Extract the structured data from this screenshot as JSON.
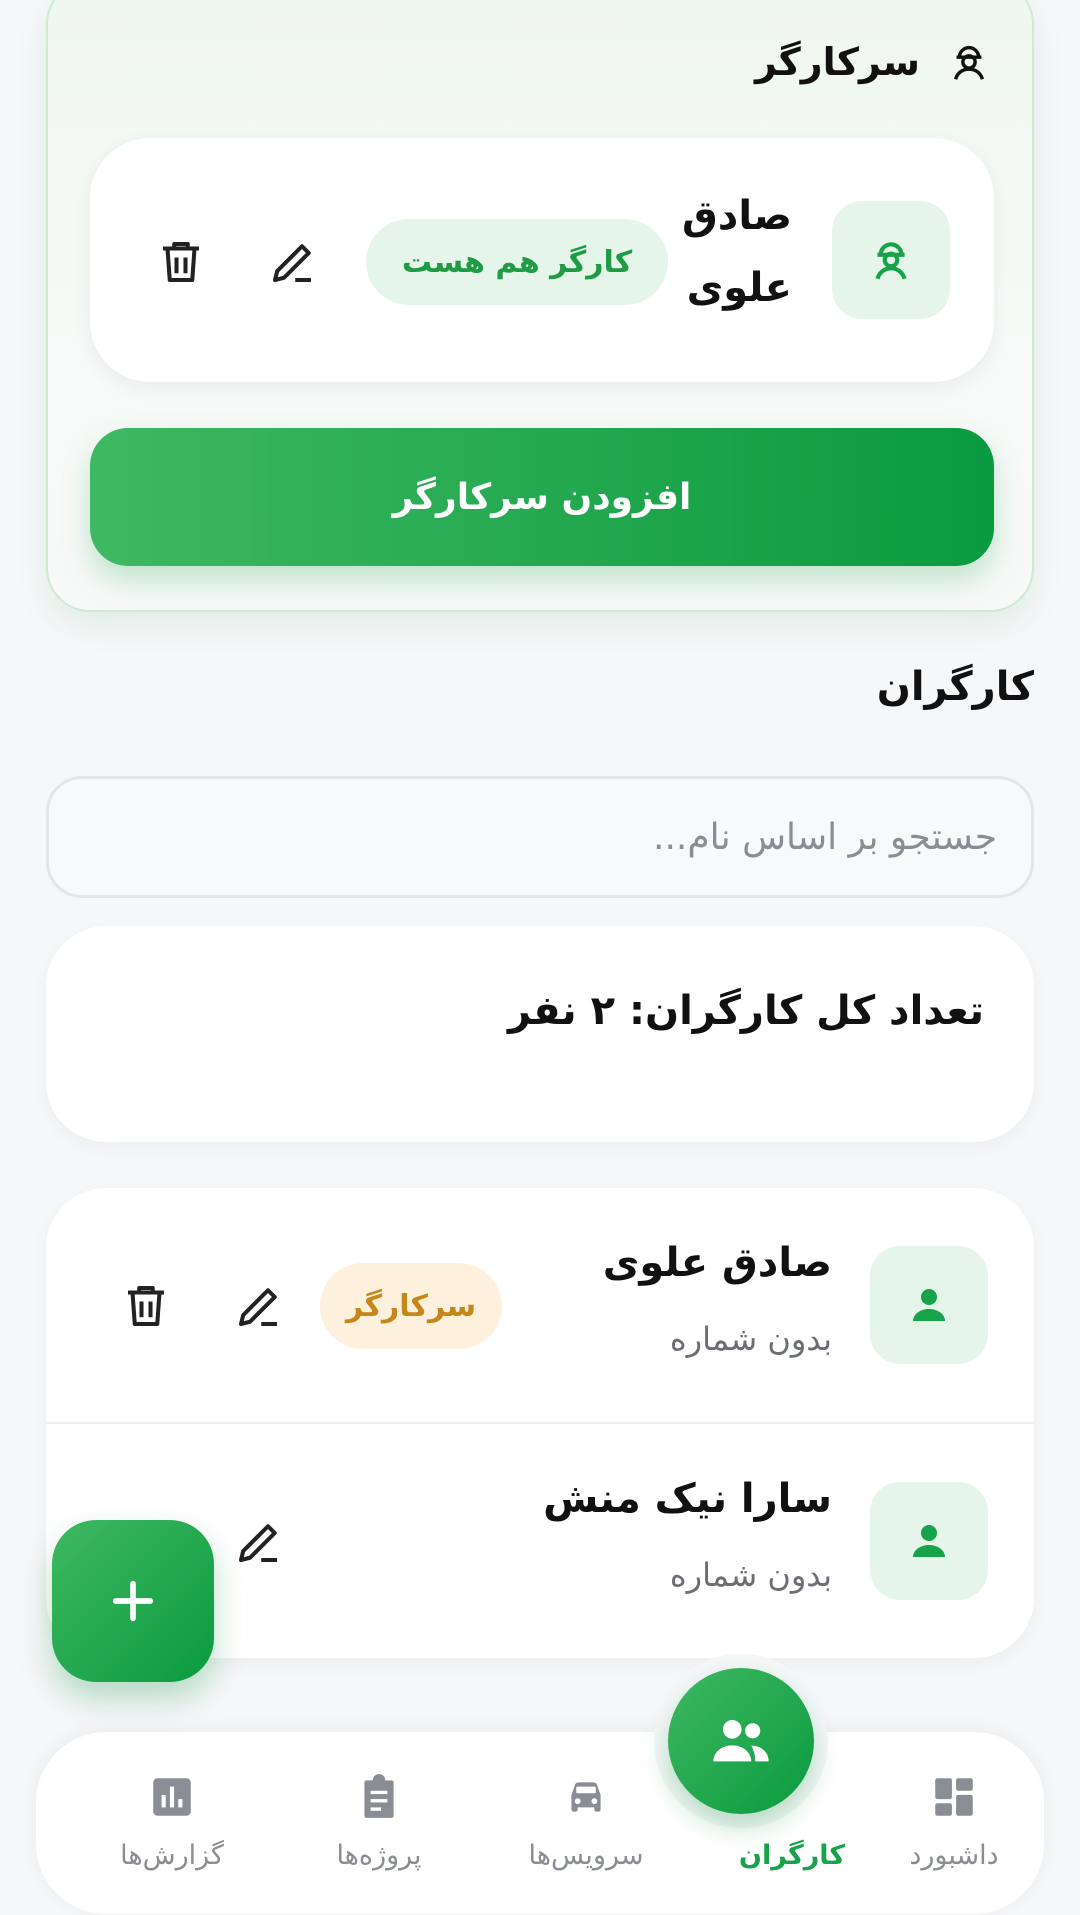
{
  "supervisor_section": {
    "title": "سرکارگر",
    "item": {
      "name_line1": "صادق",
      "name_line2": "علوی",
      "badge": "کارگر هم هست"
    },
    "add_button_label": "افزودن سرکارگر"
  },
  "workers_section": {
    "title": "کارگران",
    "search_placeholder": "جستجو بر اساس نام...",
    "count_text": "تعداد کل کارگران: ۲ نفر",
    "workers": [
      {
        "name": "صادق علوی",
        "phone": "بدون شماره",
        "badge": "سرکارگر"
      },
      {
        "name": "سارا نیک منش",
        "phone": "بدون شماره"
      }
    ]
  },
  "fab": {
    "icon": "plus-icon"
  },
  "bottom_nav": {
    "items": [
      {
        "label": "داشبورد",
        "icon": "dashboard-icon"
      },
      {
        "label": "کارگران",
        "icon": "group-icon",
        "active": true
      },
      {
        "label": "سرویس‌ها",
        "icon": "car-icon"
      },
      {
        "label": "پروژه‌ها",
        "icon": "clipboard-icon"
      },
      {
        "label": "گزارش‌ها",
        "icon": "bar-chart-icon"
      }
    ]
  },
  "colors": {
    "primary_green": "#16a34a",
    "light_green": "#e6f5e9",
    "amber_text": "#c6871a",
    "amber_bg": "#fdf0dc",
    "muted_text": "#8a8d93"
  }
}
